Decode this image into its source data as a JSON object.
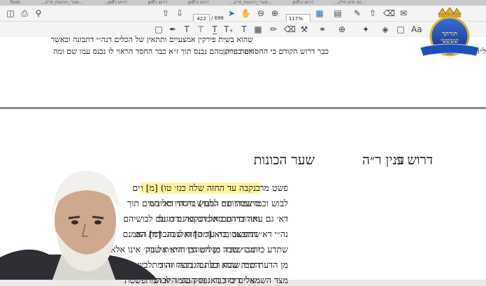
{
  "browser_tabs": [
    "Tools",
    "...שערי_הכוונות_פרק...",
    "...pdf.דרוש ו",
    "pdf.דרוש ז",
    "pdf.דרוש ח",
    "...שערי_הכוונות_פרק...",
    "pdf.דרוש ט",
    "...עץ חיים חלק..."
  ],
  "toolbar": {
    "page_current": "422",
    "page_total": "/ 696",
    "zoom": "117%"
  },
  "icons": [
    "save-icon",
    "print-icon",
    "search-icon",
    "page-up-icon",
    "page-down-icon",
    "select-arrow-icon",
    "hand-icon",
    "zoom-out-icon",
    "zoom-in-icon",
    "fit-icon",
    "comment-icon",
    "sign-icon",
    "share-icon",
    "delete-icon",
    "mail-icon",
    "pen-icon",
    "text-icon",
    "strike-icon",
    "highlight-icon",
    "eraser-icon",
    "stamp-icon",
    "attach-icon",
    "pin-icon",
    "fill-icon"
  ],
  "page1": {
    "left_line1": "שהוא בשית פירקין אמצעיים ותתאין של הכלים דנה״י דתבונה וכאשר",
    "left_line2": "איזה פרק מהם נכנס תוך ז״א כבר החסד הראוי לו נכנס עמו שם ומה",
    "right_line1": "כבר דרוש הקודם כי החסדים בהיותן",
    "edge_right": "ל״ד"
  },
  "page2": {
    "header_right": "דרוש ג׳",
    "header_center": "שער הכונות",
    "header_left": "ענין ר״ה",
    "col_right": [
      "פשט מחכמה שבה עד החזה ודאי שאינם באים",
      "לבוש וכמו שבהיותם למע׳) בה היו מלובשים תוך",
      "דא׳ גם עתה ברדתם אל הנקבה ירדו עם לבושיהם",
      "נה״י דא׳ ויתפשטו בה עד החזה שבה. [מ] האמנם",
      "שתדע כי מה שיורד מן המוחין דז״א אל נוק׳ אינו אלא",
      "מן הדעת שבו שהוא דעת הגבורה וזה מתלבש ג״כ",
      "מצד השמאלי דיסוד דא׳ וזו הבח׳ היא המתפשטת"
    ],
    "col_left": [
      "בנקבה עד החזה שלה כנז׳ טו) [מ] ו",
      "סתומות ע״י הלבוש דיסוד דא׳ המ",
      "ואורותיהם סתומים ואינם מגולי",
      "שנתבאר בו״א [מט] ואלו הגבורות הם",
      "והגבו׳ שבה ושליש גבו׳ הת״ת שבה",
      "הת״ת שבה וכל גבו׳ דנצח והוד",
      "מגולים כי כבר נפסק ונגמר לבוש"
    ]
  },
  "logo": {
    "text": "תורתך שעשעי"
  }
}
